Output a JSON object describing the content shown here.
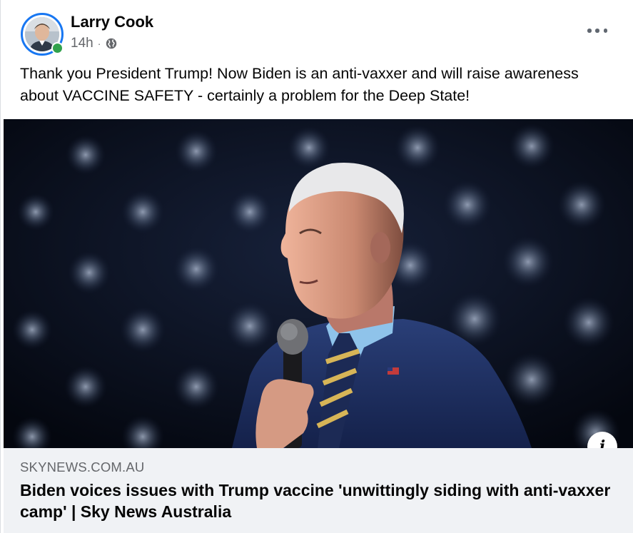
{
  "post": {
    "author": "Larry Cook",
    "time": "14h",
    "separator": "·",
    "privacy_icon": "globe-icon",
    "more_icon": "more-options-icon",
    "text": "Thank you President Trump! Now Biden is an anti-vaxxer and will raise awareness about VACCINE SAFETY - certainly a problem for the Deep State!"
  },
  "link": {
    "domain": "SKYNEWS.COM.AU",
    "headline": "Biden voices issues with Trump vaccine 'unwittingly siding with anti-vaxxer camp' | Sky News Australia",
    "info_icon": "i"
  },
  "colors": {
    "accent": "#1877f2",
    "online": "#31a24c",
    "meta_text": "#65676b",
    "footer_bg": "#f0f2f5"
  }
}
